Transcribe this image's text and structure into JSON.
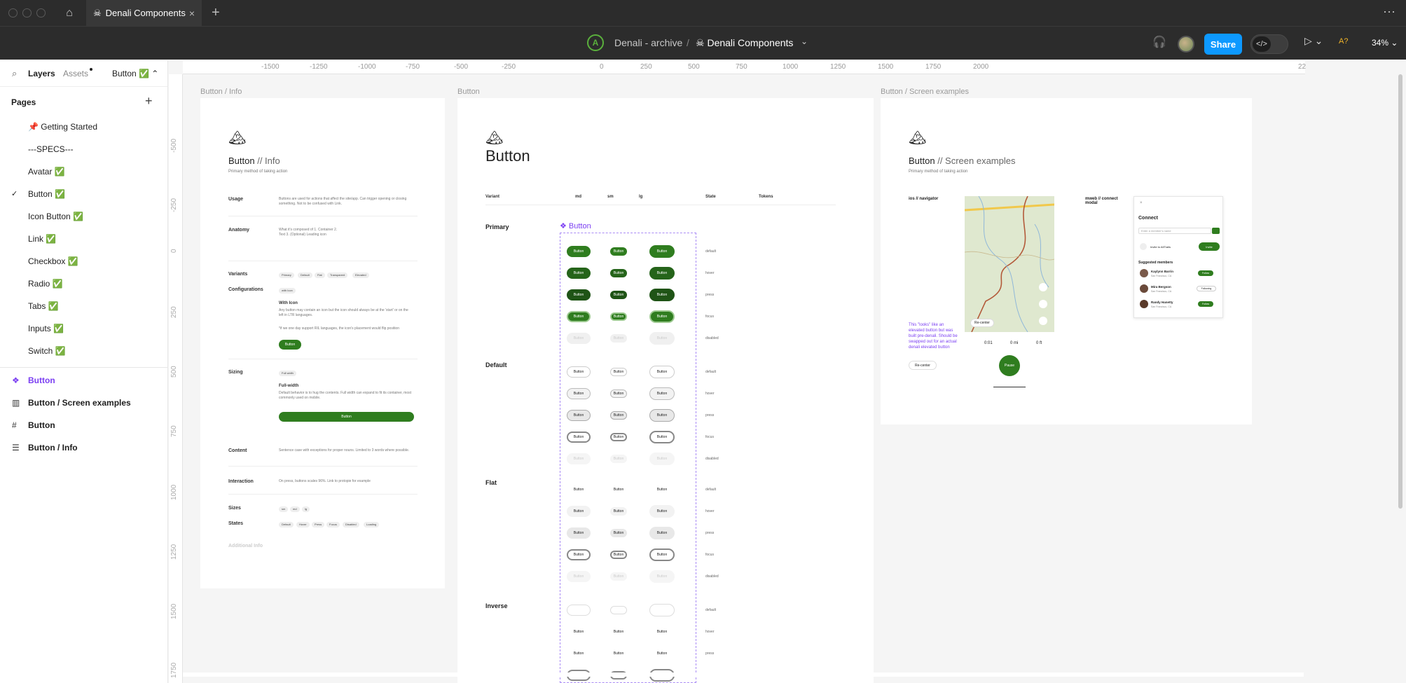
{
  "titlebar": {
    "tab_title": "Denali Components",
    "tab_icon": "skull-icon"
  },
  "toolbar": {
    "project": "Denali - archive",
    "separator": "/",
    "file": "Denali Components",
    "share_label": "Share",
    "zoom": "34%",
    "font_badge": "A?"
  },
  "sidebar": {
    "tab_layers": "Layers",
    "tab_assets": "Assets",
    "current_page": "Button ✅",
    "pages_header": "Pages",
    "pages": [
      {
        "label": "📌 Getting Started",
        "selected": false
      },
      {
        "label": "---SPECS---",
        "selected": false
      },
      {
        "label": "Avatar ✅",
        "selected": false
      },
      {
        "label": "Button ✅",
        "selected": true
      },
      {
        "label": "Icon Button ✅",
        "selected": false
      },
      {
        "label": "Link ✅",
        "selected": false
      },
      {
        "label": "Checkbox ✅",
        "selected": false
      },
      {
        "label": "Radio ✅",
        "selected": false
      },
      {
        "label": "Tabs ✅",
        "selected": false
      },
      {
        "label": "Inputs ✅",
        "selected": false
      },
      {
        "label": "Switch ✅",
        "selected": false
      }
    ],
    "layers": [
      {
        "label": "Button",
        "icon": "component-icon"
      },
      {
        "label": "Button / Screen examples",
        "icon": "frame-columns-icon"
      },
      {
        "label": "Button",
        "icon": "frame-hash-icon"
      },
      {
        "label": "Button / Info",
        "icon": "frame-rows-icon"
      }
    ]
  },
  "ruler": {
    "top": [
      "-1500",
      "-1250",
      "-1000",
      "-750",
      "-500",
      "-250",
      "0",
      "250",
      "500",
      "750",
      "1000",
      "1250",
      "1500",
      "1750",
      "2000",
      "22"
    ],
    "left": [
      "-500",
      "-250",
      "0",
      "250",
      "500",
      "750",
      "1000",
      "1250",
      "1500",
      "1750"
    ]
  },
  "frames": {
    "info_label": "Button  / Info",
    "button_label": "Button",
    "screen_label": "Button / Screen examples"
  },
  "info": {
    "title_a": "Button",
    "title_b": " // Info",
    "subtitle": "Primary method of taking action",
    "usage_label": "Usage",
    "usage_text": "Buttons are used for actions that affect the site/app. Can trigger opening or closing something. Not to be confused with Link.",
    "anatomy_label": "Anatomy",
    "anatomy_text": "What it's composed of 1. Container 2. Text 3. (Optional) Leading icon",
    "variants_label": "Variants",
    "variants": [
      "Primary",
      "Default",
      "Flat",
      "Transparent",
      "Elevated"
    ],
    "config_label": "Configurations",
    "config_chip": "with Icon",
    "with_icon_hd": "With Icon",
    "with_icon_text": "Any button may contain an icon but the icon should always be at the 'start' or on the left in LTR languages.",
    "with_icon_text2": "*if we one day support RIL languages, the icon's placement would flip position",
    "sample_button": "Button",
    "sizing_label": "Sizing",
    "sizing_chip": "Full width",
    "full_width_hd": "Full-width",
    "full_width_text": "Default behavior is to hug the contents. Full width can expand to fit its container, most commonly used on mobile.",
    "content_label": "Content",
    "content_text": "Sentence case with exceptions for proper nouns. Limited to 3 words where possible.",
    "interaction_label": "Interaction",
    "interaction_text": "On press, buttons scales 96%. Link to protopie for example",
    "sizes_label": "Sizes",
    "sizes": [
      "sm",
      "md",
      "lg"
    ],
    "states_label": "States",
    "states": [
      "Default",
      "Hover",
      "Press",
      "Focus",
      "Disabled",
      "Loading"
    ],
    "additional_label": "Additional Info"
  },
  "button_frame": {
    "title": "Button",
    "columns": [
      "Variant",
      "md",
      "sm",
      "lg",
      "State",
      "Tokens"
    ],
    "component_label": "Button",
    "sections": [
      "Primary",
      "Default",
      "Flat",
      "Inverse"
    ],
    "btn_label": "Button",
    "states": [
      "default",
      "hover",
      "press",
      "focus",
      "disabled"
    ]
  },
  "screen_frame": {
    "title_a": "Button",
    "title_b": " // Screen examples",
    "subtitle": "Primary method of taking action",
    "ios_label": "ios // navigator",
    "mweb_label": "mweb // connect modal",
    "note": "This \"looks\" like an elevated button but was built pre-denali. Should be swapped out for an actual denali elevated button",
    "recenter": "Re-center",
    "time": "0:01",
    "miles": "0 mi",
    "feet": "0 ft",
    "pause": "Pause",
    "connect_title": "Connect",
    "connect_placeholder": "Enter a member's name",
    "invite_text": "Invite to AllTrails",
    "invite_btn": "Invite",
    "suggested": "Suggested members",
    "members": [
      {
        "name": "Kaylynn Barrin",
        "loc": "San Francisco, CA",
        "action": "Follow"
      },
      {
        "name": "Mira Bergson",
        "loc": "San Francisco, CA",
        "action": "Following"
      },
      {
        "name": "Randy Hanetty",
        "loc": "San Francisco, CA",
        "action": "Follow"
      }
    ]
  },
  "colors": {
    "primary_green": "#2f7d1f",
    "accent_blue": "#0d99ff",
    "component_purple": "#7b3ff2"
  }
}
